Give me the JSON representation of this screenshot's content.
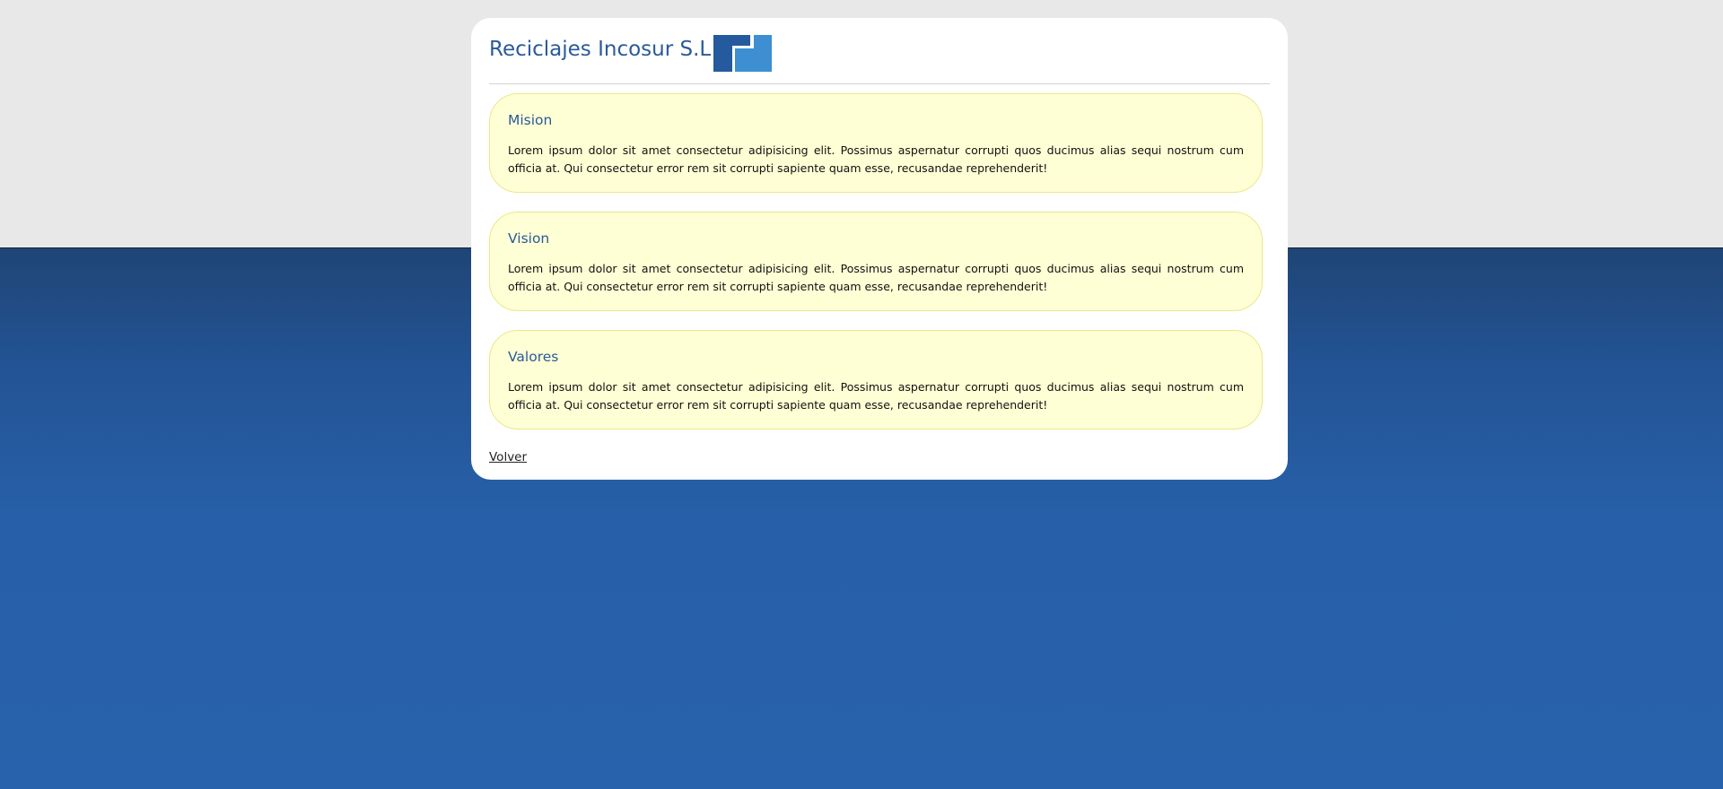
{
  "header": {
    "title": "Reciclajes Incosur S.L",
    "logo_icon": "company-logo-icon"
  },
  "sections": [
    {
      "title": "Mision",
      "text": "Lorem ipsum dolor sit amet consectetur adipisicing elit. Possimus aspernatur corrupti quos ducimus alias sequi nostrum cum officia at. Qui consectetur error rem sit corrupti sapiente quam esse, recusandae reprehenderit!"
    },
    {
      "title": "Vision",
      "text": "Lorem ipsum dolor sit amet consectetur adipisicing elit. Possimus aspernatur corrupti quos ducimus alias sequi nostrum cum officia at. Qui consectetur error rem sit corrupti sapiente quam esse, recusandae reprehenderit!"
    },
    {
      "title": "Valores",
      "text": "Lorem ipsum dolor sit amet consectetur adipisicing elit. Possimus aspernatur corrupti quos ducimus alias sequi nostrum cum officia at. Qui consectetur error rem sit corrupti sapiente quam esse, recusandae reprehenderit!"
    }
  ],
  "footer": {
    "back_label": "Volver"
  },
  "colors": {
    "accent": "#2a5a9b",
    "box_background": "#ffffd5",
    "box_border": "#ece78a",
    "page_top": "#e8e8e8",
    "page_bottom": "#2862ac"
  }
}
